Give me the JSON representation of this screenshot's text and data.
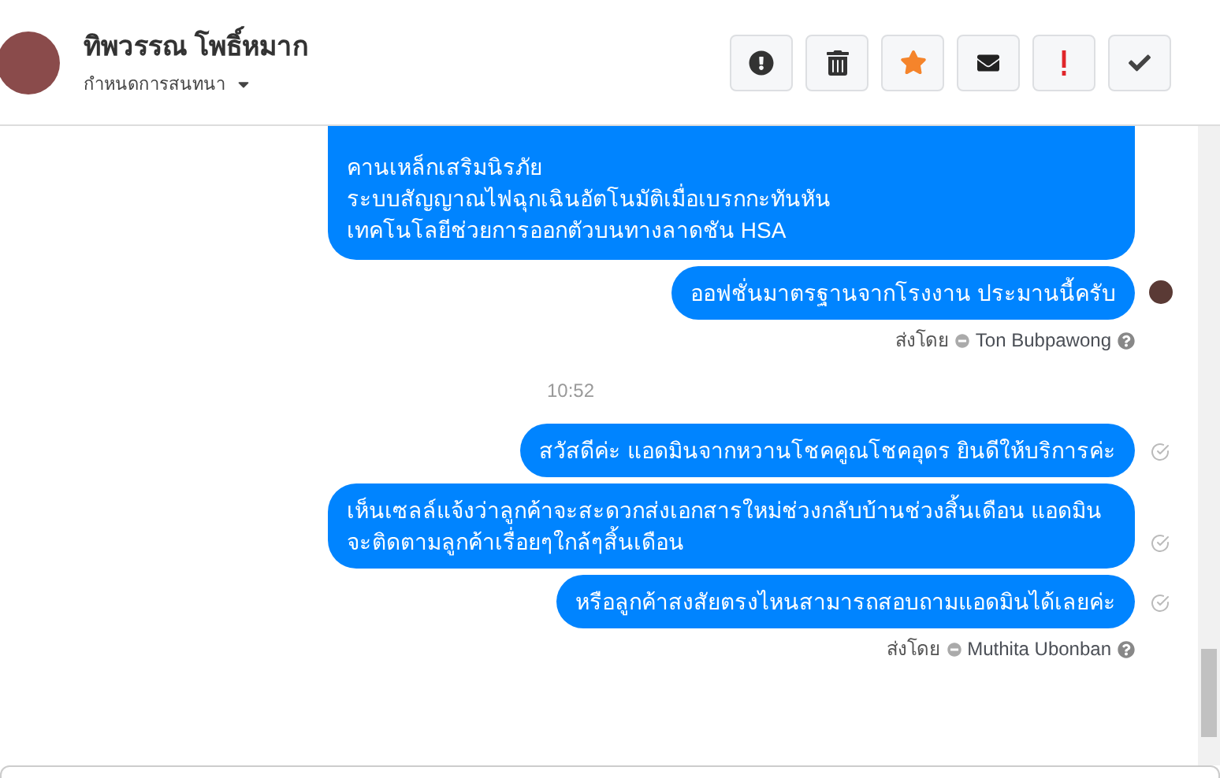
{
  "header": {
    "name": "ทิพวรรณ โพธิ์หมาก",
    "subtitle": "กำหนดการสนทนา"
  },
  "actions": [
    {
      "kind": "alert"
    },
    {
      "kind": "trash"
    },
    {
      "kind": "star"
    },
    {
      "kind": "mail"
    },
    {
      "kind": "important"
    },
    {
      "kind": "done"
    }
  ],
  "messages": [
    {
      "kind": "message",
      "lines": [
        "คานเหล็กเสริมนิรภัย",
        "ระบบสัญญาณไฟฉุกเฉินอัตโนมัติเมื่อเบรกกะทันหัน",
        "เทคโนโลยีช่วยการออกตัวบนทางลาดชัน HSA"
      ],
      "seen": false,
      "delivered": false,
      "cut": true
    },
    {
      "kind": "message",
      "lines": [
        "ออฟชั่นมาตรฐานจากโรงงาน ประมานนี้ครับ"
      ],
      "seen": true,
      "delivered": false,
      "cut": false
    },
    {
      "kind": "sender",
      "prefix": "ส่งโดย",
      "name": "Ton Bubpawong"
    },
    {
      "kind": "time",
      "text": "10:52"
    },
    {
      "kind": "message",
      "lines": [
        "สวัสดีค่ะ แอดมินจากหวานโชคคูณโชคอุดร ยินดีให้บริการค่ะ"
      ],
      "seen": false,
      "delivered": true,
      "cut": false
    },
    {
      "kind": "message",
      "lines": [
        "เห็นเซลล์แจ้งว่าลูกค้าจะสะดวกส่งเอกสารใหม่ช่วงกลับบ้านช่วงสิ้นเดือน แอดมินจะติดตามลูกค้าเรื่อยๆใกล้ๆสิ้นเดือน"
      ],
      "seen": false,
      "delivered": true,
      "cut": false
    },
    {
      "kind": "message",
      "lines": [
        "หรือลูกค้าสงสัยตรงไหนสามารถสอบถามแอดมินได้เลยค่ะ"
      ],
      "seen": false,
      "delivered": true,
      "cut": false
    },
    {
      "kind": "sender",
      "prefix": "ส่งโดย",
      "name": "Muthita Ubonban"
    }
  ]
}
